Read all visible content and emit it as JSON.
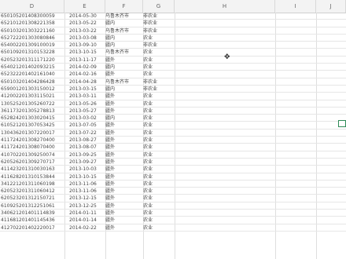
{
  "columns": [
    "D",
    "E",
    "F",
    "G",
    "H",
    "I",
    "J"
  ],
  "rows": [
    [
      "650105201408300059",
      "2014-05-30",
      "乌鲁木齐市",
      "非农业"
    ],
    [
      "652101201308221358",
      "2013-05-22",
      "疆内",
      "非农业"
    ],
    [
      "650103201303221160",
      "2013-03-22",
      "乌鲁木齐市",
      "非农业"
    ],
    [
      "652722201303080846",
      "2013-03-08",
      "疆内",
      "农业"
    ],
    [
      "654002201309100019",
      "2013-09-10",
      "疆内",
      "非农业"
    ],
    [
      "650109201310153228",
      "2013-10-15",
      "乌鲁木齐市",
      "农业"
    ],
    [
      "620523201311171220",
      "2013-11-17",
      "疆外",
      "农业"
    ],
    [
      "654021201402093215",
      "2014-02-09",
      "疆内",
      "农业"
    ],
    [
      "652322201402161040",
      "2014-02-16",
      "疆外",
      "农业"
    ],
    [
      "650103201404286428",
      "2014-04-28",
      "乌鲁木齐市",
      "非农业"
    ],
    [
      "659001201303150012",
      "2013-03-15",
      "疆内",
      "非农业"
    ],
    [
      "412002201303115021",
      "2013-03-11",
      "疆外",
      "农业"
    ],
    [
      "130525201305260722",
      "2013-05-26",
      "疆外",
      "农业"
    ],
    [
      "361173201305278813",
      "2013-05-27",
      "疆外",
      "农业"
    ],
    [
      "652824201303020415",
      "2013-03-02",
      "疆内",
      "农业"
    ],
    [
      "610521201307053425",
      "2013-07-05",
      "疆外",
      "农业"
    ],
    [
      "130436201307220017",
      "2013-07-22",
      "疆外",
      "农业"
    ],
    [
      "411724201308270400",
      "2013-08-27",
      "疆外",
      "农业"
    ],
    [
      "411724201308070400",
      "2013-08-07",
      "疆外",
      "农业"
    ],
    [
      "410702201309250074",
      "2013-09-25",
      "疆外",
      "农业"
    ],
    [
      "620526201309270717",
      "2013-09-27",
      "疆外",
      "农业"
    ],
    [
      "411423201310030163",
      "2013-10-03",
      "疆外",
      "农业"
    ],
    [
      "411628201310153844",
      "2013-10-15",
      "疆外",
      "农业"
    ],
    [
      "341221201311060198",
      "2013-11-06",
      "疆外",
      "农业"
    ],
    [
      "620523201311060412",
      "2013-11-06",
      "疆外",
      "农业"
    ],
    [
      "620523201312150721",
      "2013-12-15",
      "疆外",
      "农业"
    ],
    [
      "610925201312251061",
      "2013-12-25",
      "疆外",
      "农业"
    ],
    [
      "340621201401114839",
      "2014-01-11",
      "疆外",
      "农业"
    ],
    [
      "411681201401145436",
      "2014-01-14",
      "疆外",
      "农业"
    ],
    [
      "412702201402220017",
      "2014-02-22",
      "疆外",
      "农业"
    ]
  ]
}
